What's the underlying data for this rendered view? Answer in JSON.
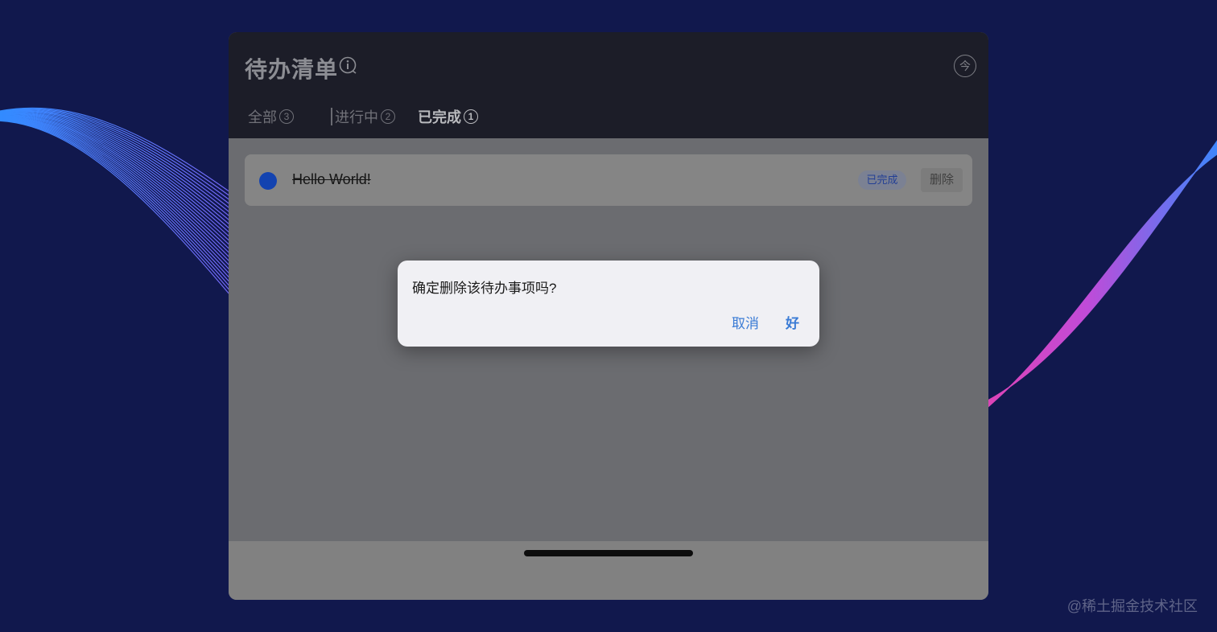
{
  "app": {
    "title": "待办清单"
  },
  "tabs": [
    {
      "label": "全部",
      "count": "3"
    },
    {
      "label": "进行中",
      "count": "2"
    },
    {
      "label": "已完成",
      "count": "1"
    }
  ],
  "header": {
    "clock_glyph": "今"
  },
  "todos": [
    {
      "text": "Hello World!",
      "status": "已完成",
      "delete_label": "删除"
    }
  ],
  "dialog": {
    "message": "确定删除该待办事项吗?",
    "cancel_label": "取消",
    "ok_label": "好"
  },
  "watermark": "@稀土掘金技术社区",
  "colors": {
    "background": "#11184d",
    "accent": "#3a7bd5",
    "check": "#1343b0"
  }
}
